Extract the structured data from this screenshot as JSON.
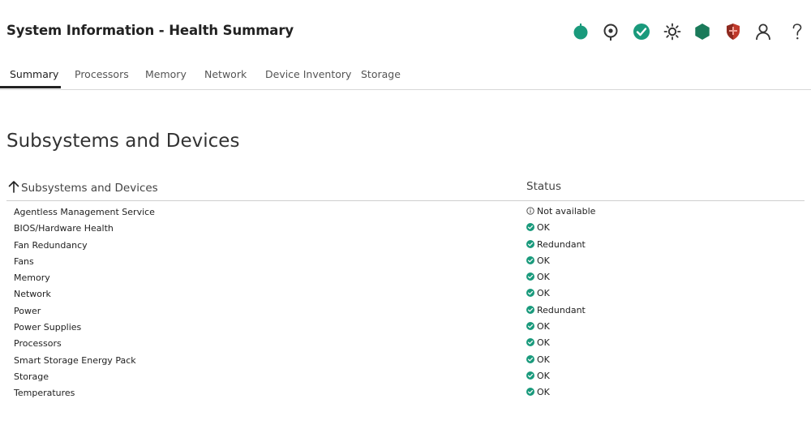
{
  "header": {
    "title": "System Information - Health Summary",
    "icons": [
      {
        "name": "power-icon",
        "color": "#1a9a7c"
      },
      {
        "name": "location-icon",
        "color": "#333333"
      },
      {
        "name": "health-ok-icon",
        "color": "#1a9a7c"
      },
      {
        "name": "uid-light-icon",
        "color": "#333333"
      },
      {
        "name": "hexagon-icon",
        "color": "#1a7a5a"
      },
      {
        "name": "security-shield-icon",
        "color": "#c0392b"
      },
      {
        "name": "user-icon",
        "color": "#333333"
      },
      {
        "name": "help-icon",
        "color": "#333333"
      }
    ]
  },
  "tabs": [
    {
      "label": "Summary",
      "active": true
    },
    {
      "label": "Processors",
      "active": false
    },
    {
      "label": "Memory",
      "active": false
    },
    {
      "label": "Network",
      "active": false
    },
    {
      "label": "Device Inventory",
      "active": false
    },
    {
      "label": "Storage",
      "active": false
    }
  ],
  "section": {
    "title": "Subsystems and Devices"
  },
  "table": {
    "columns": [
      "Subsystems and Devices",
      "Status"
    ],
    "rows": [
      {
        "name": "Agentless Management Service",
        "status": "Not available",
        "icon": "info-icon"
      },
      {
        "name": "BIOS/Hardware Health",
        "status": "OK",
        "icon": "ok-icon"
      },
      {
        "name": "Fan Redundancy",
        "status": "Redundant",
        "icon": "ok-icon"
      },
      {
        "name": "Fans",
        "status": "OK",
        "icon": "ok-icon"
      },
      {
        "name": "Memory",
        "status": "OK",
        "icon": "ok-icon"
      },
      {
        "name": "Network",
        "status": "OK",
        "icon": "ok-icon"
      },
      {
        "name": "Power",
        "status": "Redundant",
        "icon": "ok-icon"
      },
      {
        "name": "Power Supplies",
        "status": "OK",
        "icon": "ok-icon"
      },
      {
        "name": "Processors",
        "status": "OK",
        "icon": "ok-icon"
      },
      {
        "name": "Smart Storage Energy Pack",
        "status": "OK",
        "icon": "ok-icon"
      },
      {
        "name": "Storage",
        "status": "OK",
        "icon": "ok-icon"
      },
      {
        "name": "Temperatures",
        "status": "OK",
        "icon": "ok-icon"
      }
    ]
  },
  "colors": {
    "accent": "#1a9a7c",
    "text": "#222222",
    "divider": "#d8d8d8"
  }
}
